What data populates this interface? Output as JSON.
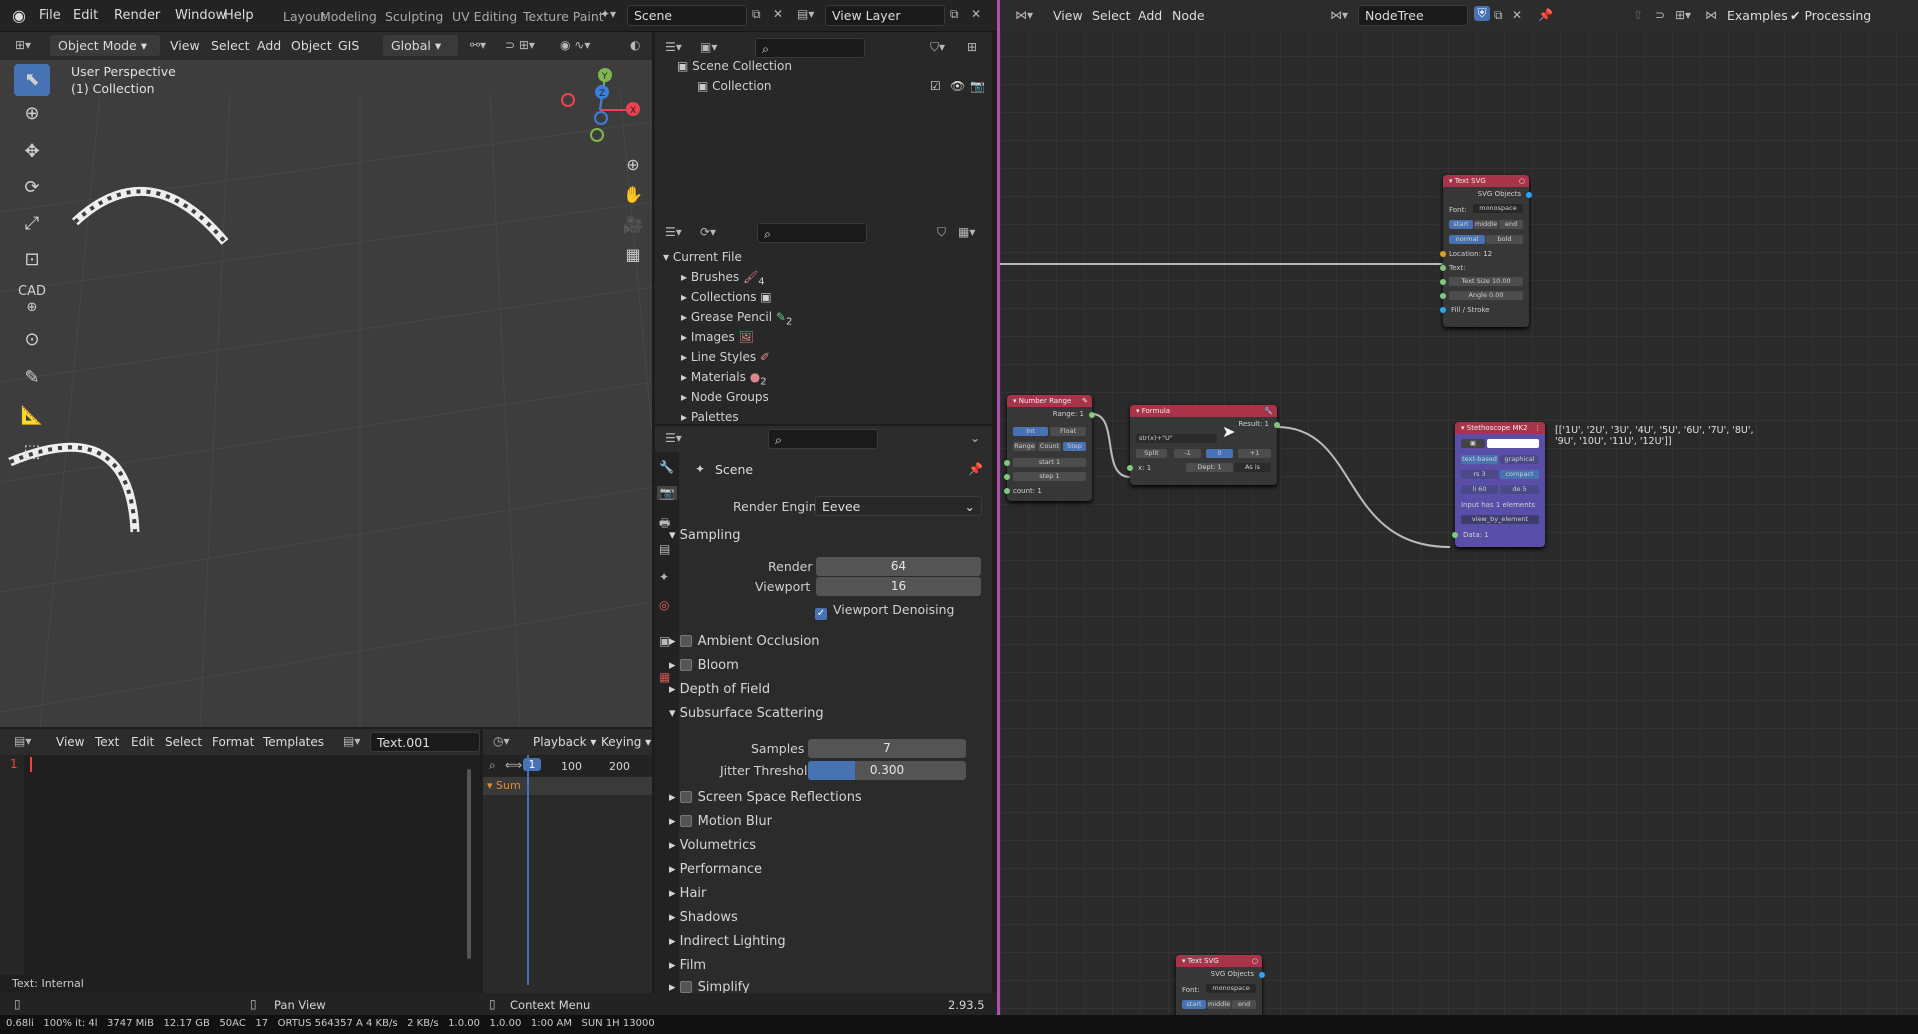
{
  "topbar": {
    "menus": [
      "File",
      "Edit",
      "Render",
      "Window",
      "Help"
    ],
    "workspaces": [
      "Layout",
      "Modeling",
      "Sculpting",
      "UV Editing",
      "Texture Paint"
    ],
    "scene": "Scene",
    "view_layer": "View Layer"
  },
  "viewport": {
    "mode": "Object Mode",
    "menus": [
      "View",
      "Select",
      "Add",
      "Object",
      "GIS"
    ],
    "orientation": "Global",
    "perspective": "User Perspective",
    "collection": "(1) Collection",
    "gizmo": {
      "x": "X",
      "y": "Y",
      "z": "Z"
    },
    "cad_label": "CAD"
  },
  "outliner": {
    "items": [
      {
        "label": "Scene Collection"
      },
      {
        "label": "Collection"
      }
    ]
  },
  "datablocks": {
    "root": "Current File",
    "items": [
      {
        "label": "Brushes",
        "badge": "4"
      },
      {
        "label": "Collections",
        "badge": ""
      },
      {
        "label": "Grease Pencil",
        "badge": "2"
      },
      {
        "label": "Images",
        "badge": ""
      },
      {
        "label": "Line Styles",
        "badge": ""
      },
      {
        "label": "Materials",
        "badge": "2"
      },
      {
        "label": "Node Groups",
        "badge": ""
      },
      {
        "label": "Palettes",
        "badge": ""
      }
    ]
  },
  "properties": {
    "title": "Scene",
    "render_engine_label": "Render Engine",
    "render_engine": "Eevee",
    "sampling": {
      "label": "Sampling",
      "render_label": "Render",
      "render": "64",
      "viewport_label": "Viewport",
      "viewport": "16",
      "denoise": "Viewport Denoising"
    },
    "panels_a": [
      "Ambient Occlusion",
      "Bloom",
      "Depth of Field"
    ],
    "sss": {
      "label": "Subsurface Scattering",
      "samples_label": "Samples",
      "samples": "7",
      "jitter_label": "Jitter Threshold",
      "jitter": "0.300",
      "jitter_fraction": 0.3
    },
    "panels_b": [
      "Screen Space Reflections",
      "Motion Blur",
      "Volumetrics",
      "Performance",
      "Hair",
      "Shadows",
      "Indirect Lighting",
      "Film",
      "Simplify"
    ]
  },
  "text_editor": {
    "menus": [
      "View",
      "Text",
      "Edit",
      "Select",
      "Format",
      "Templates"
    ],
    "textname": "Text.001",
    "line": "1",
    "footer": "Text: Internal"
  },
  "timeline": {
    "menus": [
      "Playback",
      "Keying"
    ],
    "frame": "1",
    "ticks": [
      "100",
      "200"
    ],
    "summary": "Sum"
  },
  "node_editor": {
    "menus": [
      "View",
      "Select",
      "Add",
      "Node"
    ],
    "tree": "NodeTree",
    "examples": "Examples",
    "processing": "Processing",
    "output_text": "[['1U', '2U', '3U', '4U', '5U', '6U', '7U', '8U', '9U', '10U', '11U', '12U']]",
    "nodes": {
      "textsvg1": {
        "title": "Text SVG",
        "out": "SVG Objects",
        "font_label": "Font:",
        "font": "monospace",
        "align": [
          "start",
          "middle",
          "end"
        ],
        "weight": [
          "normal",
          "bold"
        ],
        "location": "Location: 12",
        "text": "Text:",
        "size_label": "Text Size",
        "size": "10.00",
        "angle_label": "Angle",
        "angle": "0.00",
        "fill": "Fill / Stroke"
      },
      "numrange": {
        "title": "Number Range",
        "out": "Range: 1",
        "types": [
          "Int",
          "Float"
        ],
        "modes": [
          "Range",
          "Count",
          "Step"
        ],
        "start": "start",
        "start_v": "1",
        "step": "step",
        "step_v": "1",
        "count": "count: 1"
      },
      "formula": {
        "title": "Formula",
        "out": "Result: 1",
        "expr": "str(x)+\"U\"",
        "split": "Split",
        "vals": [
          "-1",
          "0",
          "+1"
        ],
        "x": "x: 1",
        "depth": "Dept: 1",
        "asis": "As is"
      },
      "steth": {
        "title": "Stethoscope MK2",
        "modes": [
          "text-based",
          "graphical"
        ],
        "rs": "rs 3",
        "compact": "compact",
        "li": "li 60",
        "de": "de 5",
        "info": "input has 1 elements",
        "view": "view_by_element",
        "data": "Data: 1"
      },
      "textsvg2": {
        "title": "Text SVG",
        "out": "SVG Objects",
        "font_label": "Font:",
        "font": "monospace",
        "align": [
          "start",
          "middle",
          "end"
        ]
      }
    }
  },
  "status": {
    "left": "",
    "pan": "Pan View",
    "ctx": "Context Menu",
    "version": "2.93.5"
  },
  "bottom": {
    "text": "0.68li   100% it: 4l   3747 MiB   12.17 GB   50AC   17   ORTUS 564357 A 4 KB/s   2 KB/s   1.0.00   1.0.00   1:00 AM   SUN 1H 13000"
  }
}
